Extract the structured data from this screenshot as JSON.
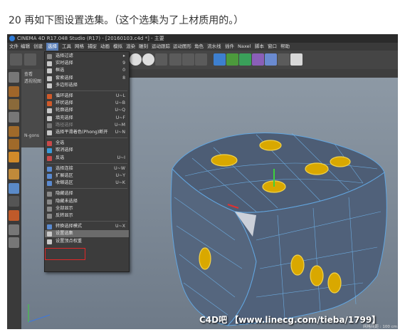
{
  "caption": "20 再如下图设置选集。（这个选集为了上材质用的。）",
  "app": {
    "title": "CINEMA 4D R17.048 Studio (R17) - [20160103.c4d *] - 主要",
    "menubar": [
      "文件",
      "编辑",
      "创建",
      "选择",
      "工具",
      "网格",
      "捕捉",
      "动画",
      "模拟",
      "渲染",
      "雕刻",
      "运动跟踪",
      "运动图形",
      "角色",
      "流水线",
      "插件",
      "Naxel",
      "脚本",
      "窗口",
      "帮助"
    ],
    "active_menu": "选择",
    "left_panel": [
      "查看",
      "透视视图",
      "N-gons"
    ]
  },
  "select_menu": {
    "items": [
      {
        "label": "选择过滤",
        "shortcut": "▸",
        "type": "submenu"
      },
      {
        "label": "实时选择",
        "shortcut": "9"
      },
      {
        "label": "框选",
        "shortcut": "0"
      },
      {
        "label": "套索选择",
        "shortcut": "8"
      },
      {
        "label": "多边形选择",
        "shortcut": ""
      },
      {
        "type": "sep"
      },
      {
        "label": "循环选择",
        "shortcut": "U~L"
      },
      {
        "label": "环状选择",
        "shortcut": "U~B"
      },
      {
        "label": "轮廓选择",
        "shortcut": "U~Q"
      },
      {
        "label": "填充选择",
        "shortcut": "U~F"
      },
      {
        "label": "路径选择",
        "shortcut": "U~M",
        "disabled": true
      },
      {
        "label": "选择平滑着色(Phong)断开",
        "shortcut": "U~N"
      },
      {
        "type": "sep"
      },
      {
        "label": "全选",
        "shortcut": ""
      },
      {
        "label": "取消选择",
        "shortcut": ""
      },
      {
        "label": "反选",
        "shortcut": "U~I"
      },
      {
        "type": "sep"
      },
      {
        "label": "选择连接",
        "shortcut": "U~W"
      },
      {
        "label": "扩展选区",
        "shortcut": "U~Y"
      },
      {
        "label": "收缩选区",
        "shortcut": "U~K"
      },
      {
        "type": "sep"
      },
      {
        "label": "隐藏选择",
        "shortcut": ""
      },
      {
        "label": "隐藏未选择",
        "shortcut": ""
      },
      {
        "label": "全部显示",
        "shortcut": ""
      },
      {
        "label": "反转显示",
        "shortcut": ""
      },
      {
        "type": "sep"
      },
      {
        "label": "转换选择模式",
        "shortcut": "U~X"
      },
      {
        "label": "设置选集",
        "shortcut": "",
        "highlighted": true
      },
      {
        "label": "设置顶点权重",
        "shortcut": ""
      }
    ]
  },
  "watermark": "C4D吧 【www.linecg.com/tieba/1799】",
  "grid_info": "网格间距 : 100 cm",
  "colors": {
    "accent": "#5a7fb8",
    "highlight_box": "#e02828",
    "wireframe": "#5aa8e8",
    "pip_yellow": "#e6b800"
  }
}
